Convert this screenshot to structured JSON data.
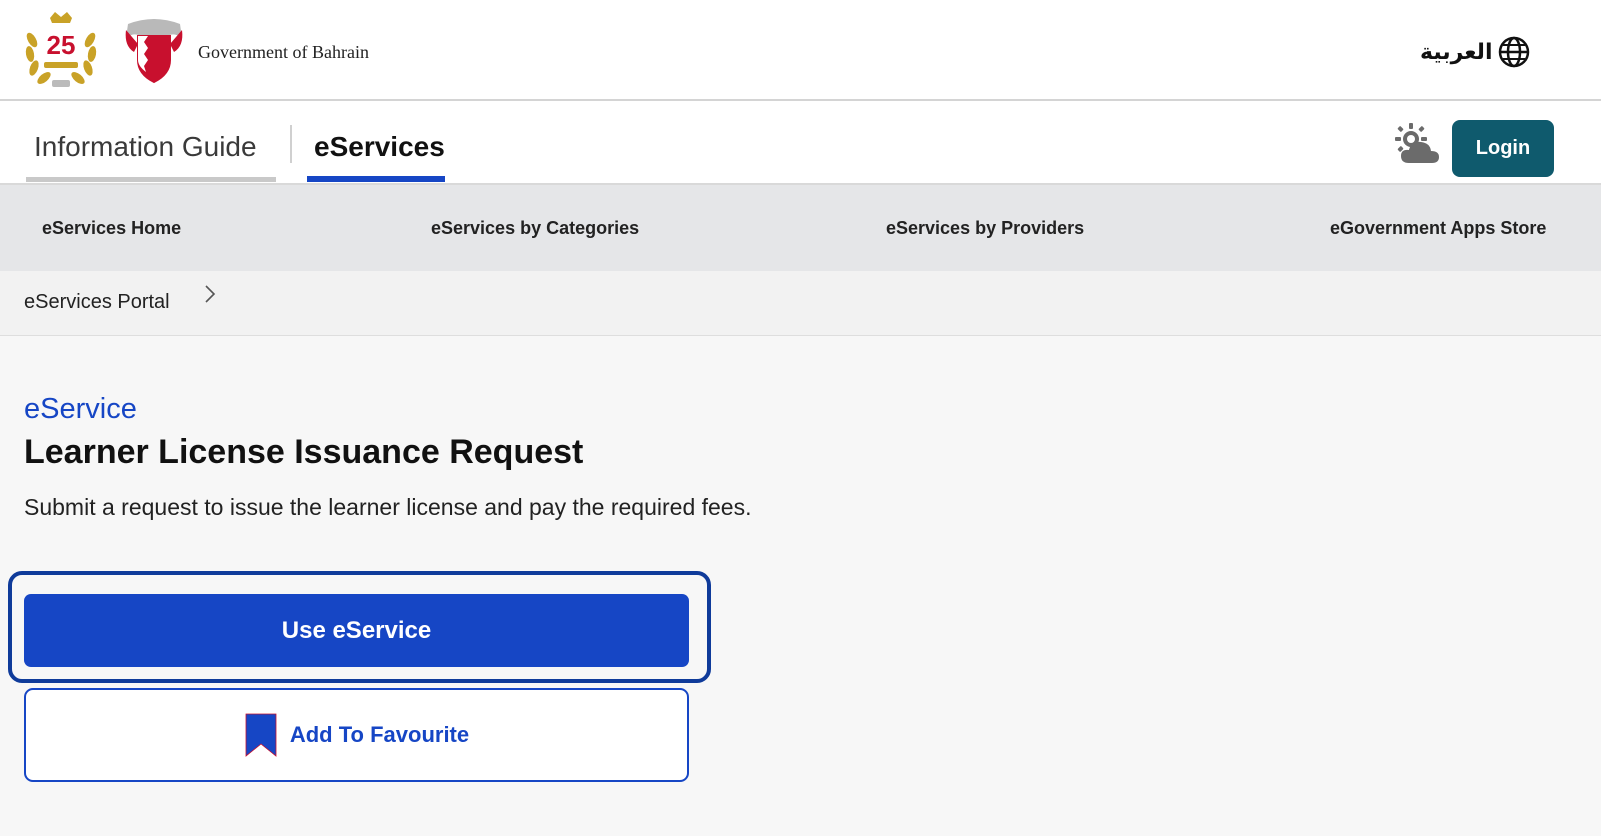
{
  "header": {
    "gov_name": "Government of Bahrain",
    "anniversary_badge": "25",
    "language_label": "العربية"
  },
  "tabs": [
    {
      "label": "Information Guide",
      "active": false
    },
    {
      "label": "eServices",
      "active": true
    }
  ],
  "login_label": "Login",
  "subnav": [
    {
      "label": "eServices Home"
    },
    {
      "label": "eServices by Categories"
    },
    {
      "label": "eServices by Providers"
    },
    {
      "label": "eGovernment Apps Store"
    }
  ],
  "breadcrumb": [
    {
      "label": "eServices Portal"
    }
  ],
  "content": {
    "kicker": "eService",
    "title": "Learner License Issuance Request",
    "description": "Submit a request to issue the learner license and pay the required fees.",
    "use_button": "Use eService",
    "favourite_button": "Add To Favourite"
  },
  "colors": {
    "primary_blue": "#1646c5",
    "login_teal": "#0f5a6d",
    "subnav_bg": "#e5e6e8",
    "bookmark_blue": "#1646c5"
  },
  "icons": {
    "language": "globe-icon",
    "weather": "weather-icon",
    "breadcrumb_separator": "chevron-right-icon",
    "favourite": "bookmark-icon"
  }
}
